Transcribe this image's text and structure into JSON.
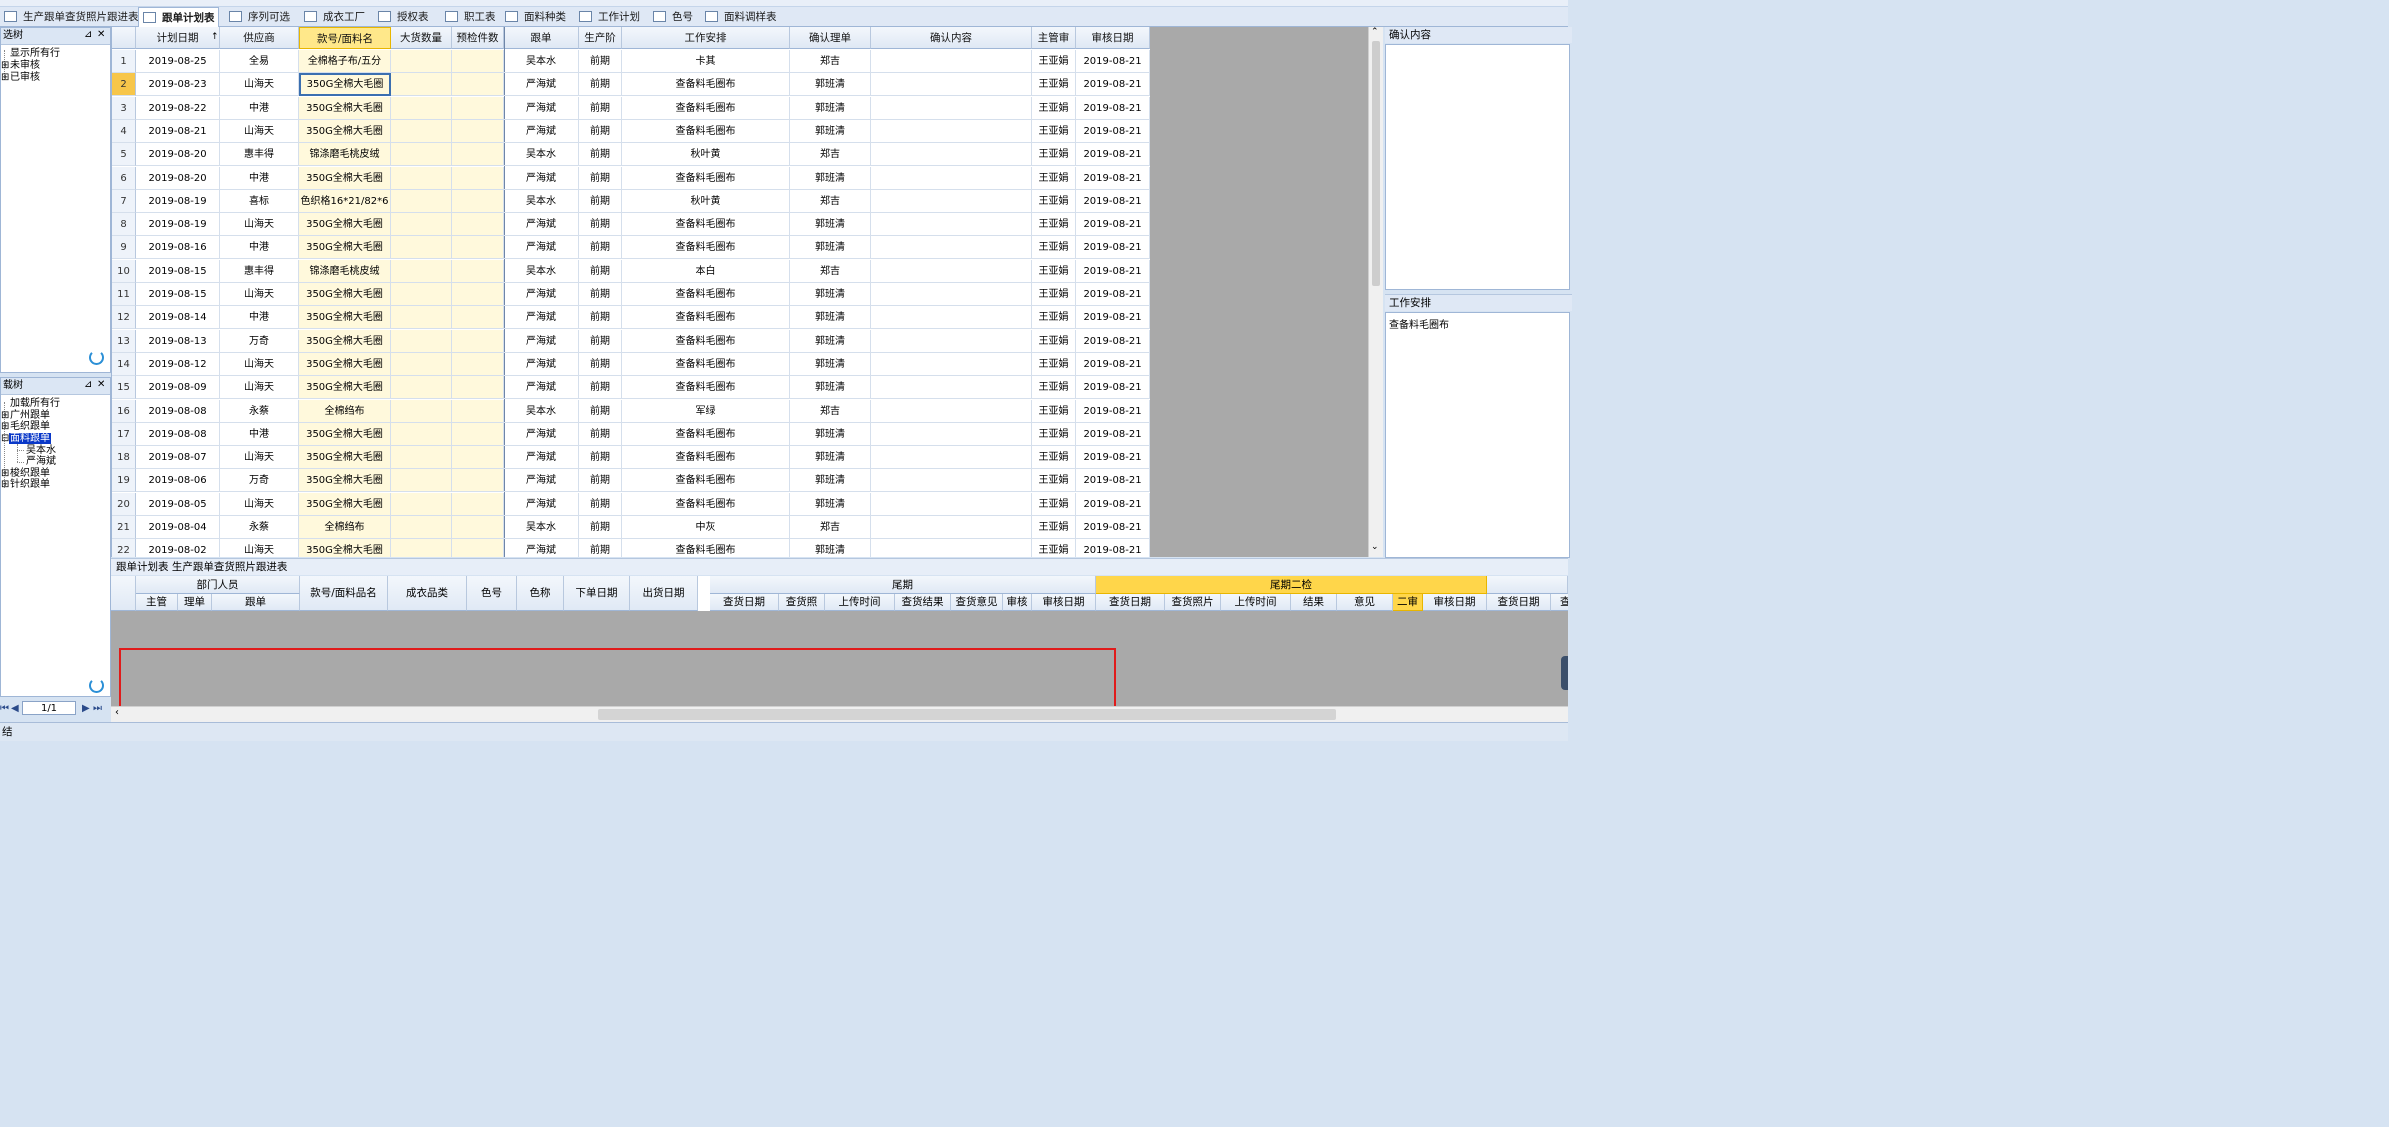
{
  "tabs": [
    {
      "label": "生产跟单查货照片跟进表",
      "active": false
    },
    {
      "label": "跟单计划表",
      "active": true
    },
    {
      "label": "序列可选",
      "active": false
    },
    {
      "label": "成衣工厂",
      "active": false
    },
    {
      "label": "授权表",
      "active": false
    },
    {
      "label": "职工表",
      "active": false
    },
    {
      "label": "面料种类",
      "active": false
    },
    {
      "label": "工作计划",
      "active": false
    },
    {
      "label": "色号",
      "active": false
    },
    {
      "label": "面料调样表",
      "active": false
    }
  ],
  "filter_tree": {
    "title": "选树",
    "items": [
      "显示所有行",
      "未审核",
      "已审核"
    ]
  },
  "load_tree": {
    "title": "载树",
    "items": [
      "加载所有行",
      "广州跟单",
      "毛织跟单",
      "面料跟单",
      "吴本水",
      "严海斌",
      "梭织跟单",
      "针织跟单"
    ]
  },
  "grid": {
    "sort_indicator": "↑",
    "columns": [
      "计划日期",
      "供应商",
      "款号/面料名",
      "大货数量",
      "预检件数",
      "跟单",
      "生产阶",
      "工作安排",
      "确认理单",
      "确认内容",
      "主管审",
      "审核日期"
    ],
    "rows": [
      [
        "1",
        "2019-08-25",
        "全易",
        "全棉格子布/五分",
        "",
        "",
        "吴本水",
        "前期",
        "卡其",
        "郑吉",
        "",
        "王亚娟",
        "2019-08-21"
      ],
      [
        "2",
        "2019-08-23",
        "山海天",
        "350G全棉大毛圈",
        "",
        "",
        "严海斌",
        "前期",
        "查备料毛圈布",
        "郭班清",
        "",
        "王亚娟",
        "2019-08-21"
      ],
      [
        "3",
        "2019-08-22",
        "中港",
        "350G全棉大毛圈",
        "",
        "",
        "严海斌",
        "前期",
        "查备料毛圈布",
        "郭班清",
        "",
        "王亚娟",
        "2019-08-21"
      ],
      [
        "4",
        "2019-08-21",
        "山海天",
        "350G全棉大毛圈",
        "",
        "",
        "严海斌",
        "前期",
        "查备料毛圈布",
        "郭班清",
        "",
        "王亚娟",
        "2019-08-21"
      ],
      [
        "5",
        "2019-08-20",
        "惠丰得",
        "锦涤磨毛桃皮绒",
        "",
        "",
        "吴本水",
        "前期",
        "秋叶黄",
        "郑吉",
        "",
        "王亚娟",
        "2019-08-21"
      ],
      [
        "6",
        "2019-08-20",
        "中港",
        "350G全棉大毛圈",
        "",
        "",
        "严海斌",
        "前期",
        "查备料毛圈布",
        "郭班清",
        "",
        "王亚娟",
        "2019-08-21"
      ],
      [
        "7",
        "2019-08-19",
        "喜标",
        "色织格16*21/82*6",
        "",
        "",
        "吴本水",
        "前期",
        "秋叶黄",
        "郑吉",
        "",
        "王亚娟",
        "2019-08-21"
      ],
      [
        "8",
        "2019-08-19",
        "山海天",
        "350G全棉大毛圈",
        "",
        "",
        "严海斌",
        "前期",
        "查备料毛圈布",
        "郭班清",
        "",
        "王亚娟",
        "2019-08-21"
      ],
      [
        "9",
        "2019-08-16",
        "中港",
        "350G全棉大毛圈",
        "",
        "",
        "严海斌",
        "前期",
        "查备料毛圈布",
        "郭班清",
        "",
        "王亚娟",
        "2019-08-21"
      ],
      [
        "10",
        "2019-08-15",
        "惠丰得",
        "锦涤磨毛桃皮绒",
        "",
        "",
        "吴本水",
        "前期",
        "本白",
        "郑吉",
        "",
        "王亚娟",
        "2019-08-21"
      ],
      [
        "11",
        "2019-08-15",
        "山海天",
        "350G全棉大毛圈",
        "",
        "",
        "严海斌",
        "前期",
        "查备料毛圈布",
        "郭班清",
        "",
        "王亚娟",
        "2019-08-21"
      ],
      [
        "12",
        "2019-08-14",
        "中港",
        "350G全棉大毛圈",
        "",
        "",
        "严海斌",
        "前期",
        "查备料毛圈布",
        "郭班清",
        "",
        "王亚娟",
        "2019-08-21"
      ],
      [
        "13",
        "2019-08-13",
        "万奇",
        "350G全棉大毛圈",
        "",
        "",
        "严海斌",
        "前期",
        "查备料毛圈布",
        "郭班清",
        "",
        "王亚娟",
        "2019-08-21"
      ],
      [
        "14",
        "2019-08-12",
        "山海天",
        "350G全棉大毛圈",
        "",
        "",
        "严海斌",
        "前期",
        "查备料毛圈布",
        "郭班清",
        "",
        "王亚娟",
        "2019-08-21"
      ],
      [
        "15",
        "2019-08-09",
        "山海天",
        "350G全棉大毛圈",
        "",
        "",
        "严海斌",
        "前期",
        "查备料毛圈布",
        "郭班清",
        "",
        "王亚娟",
        "2019-08-21"
      ],
      [
        "16",
        "2019-08-08",
        "永蔡",
        "全棉绉布",
        "",
        "",
        "吴本水",
        "前期",
        "军绿",
        "郑吉",
        "",
        "王亚娟",
        "2019-08-21"
      ],
      [
        "17",
        "2019-08-08",
        "中港",
        "350G全棉大毛圈",
        "",
        "",
        "严海斌",
        "前期",
        "查备料毛圈布",
        "郭班清",
        "",
        "王亚娟",
        "2019-08-21"
      ],
      [
        "18",
        "2019-08-07",
        "山海天",
        "350G全棉大毛圈",
        "",
        "",
        "严海斌",
        "前期",
        "查备料毛圈布",
        "郭班清",
        "",
        "王亚娟",
        "2019-08-21"
      ],
      [
        "19",
        "2019-08-06",
        "万奇",
        "350G全棉大毛圈",
        "",
        "",
        "严海斌",
        "前期",
        "查备料毛圈布",
        "郭班清",
        "",
        "王亚娟",
        "2019-08-21"
      ],
      [
        "20",
        "2019-08-05",
        "山海天",
        "350G全棉大毛圈",
        "",
        "",
        "严海斌",
        "前期",
        "查备料毛圈布",
        "郭班清",
        "",
        "王亚娟",
        "2019-08-21"
      ],
      [
        "21",
        "2019-08-04",
        "永蔡",
        "全棉绉布",
        "",
        "",
        "吴本水",
        "前期",
        "中灰",
        "郑吉",
        "",
        "王亚娟",
        "2019-08-21"
      ],
      [
        "22",
        "2019-08-02",
        "山海天",
        "350G全棉大毛圈",
        "",
        "",
        "严海斌",
        "前期",
        "查备料毛圈布",
        "郭班清",
        "",
        "王亚娟",
        "2019-08-21"
      ]
    ],
    "selected_row": 2
  },
  "right_panel": {
    "confirm_label": "确认内容",
    "confirm_value": "",
    "work_label": "工作安排",
    "work_value": "查备料毛圈布"
  },
  "bottom": {
    "caption": "跟单计划表 生产跟单查货照片跟进表",
    "group_dept": "部门人员",
    "group_tail": "尾期",
    "group_tail2": "尾期二检",
    "dept_cols": [
      "主管",
      "理单",
      "跟单"
    ],
    "cols_mid": [
      "款号/面料品名",
      "成衣品类",
      "色号",
      "色称",
      "下单日期",
      "出货日期"
    ],
    "tail_cols": [
      "查货日期",
      "查货照",
      "上传时间",
      "查货结果",
      "查货意见",
      "审核",
      "审核日期"
    ],
    "tail2_cols": [
      "查货日期",
      "查货照片",
      "上传时间",
      "结果",
      "意见",
      "二审",
      "审核日期"
    ],
    "extra_cols": [
      "查货日期",
      "查货"
    ]
  },
  "pager": {
    "value": "1/1"
  },
  "status": {
    "text": "结"
  }
}
